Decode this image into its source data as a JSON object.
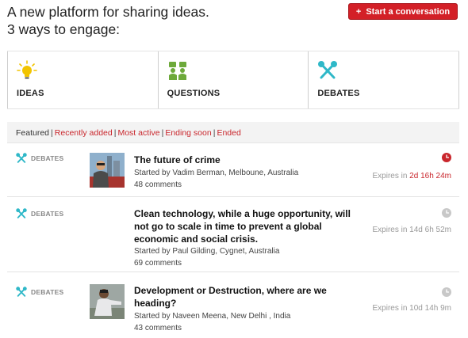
{
  "header": {
    "line1": "A new platform for sharing ideas.",
    "line2": "3 ways to engage:",
    "start_button": "Start a conversation"
  },
  "ways": [
    {
      "label": "IDEAS",
      "icon": "lightbulb-icon",
      "color": "#f2c400"
    },
    {
      "label": "QUESTIONS",
      "icon": "people-question-icon",
      "color": "#6da93a"
    },
    {
      "label": "DEBATES",
      "icon": "microphones-icon",
      "color": "#2fb8c8"
    }
  ],
  "filters": {
    "featured": "Featured",
    "recently_added": "Recently added",
    "most_active": "Most active",
    "ending_soon": "Ending soon",
    "ended": "Ended"
  },
  "items": [
    {
      "category": "DEBATES",
      "title": "The future of crime",
      "started_prefix": "Started by ",
      "author": "Vadim Berman",
      "location": ", Melboune, Australia",
      "comments": "48 comments",
      "expires_prefix": "Expires in ",
      "expires_value": "2d 16h 24m",
      "urgent": true
    },
    {
      "category": "DEBATES",
      "title_lines": [
        "Clean technology, while a huge opportunity, will",
        "not go to scale in time to prevent a global",
        "economic and social crisis."
      ],
      "started_prefix": "Started by ",
      "author": "Paul Gilding",
      "location": ", Cygnet, Australia",
      "comments": "69 comments",
      "expires_prefix": "Expires in ",
      "expires_value": "14d 6h 52m",
      "urgent": false
    },
    {
      "category": "DEBATES",
      "title_lines": [
        "Development or Destruction, where are we",
        "heading?"
      ],
      "started_prefix": "Started by ",
      "author": "Naveen Meena",
      "location": ", New Delhi , India",
      "comments": "43 comments",
      "expires_prefix": "Expires in ",
      "expires_value": "10d 14h 9m",
      "urgent": false
    }
  ],
  "colors": {
    "accent": "#d32027",
    "link": "#c9262c",
    "muted": "#999999"
  }
}
